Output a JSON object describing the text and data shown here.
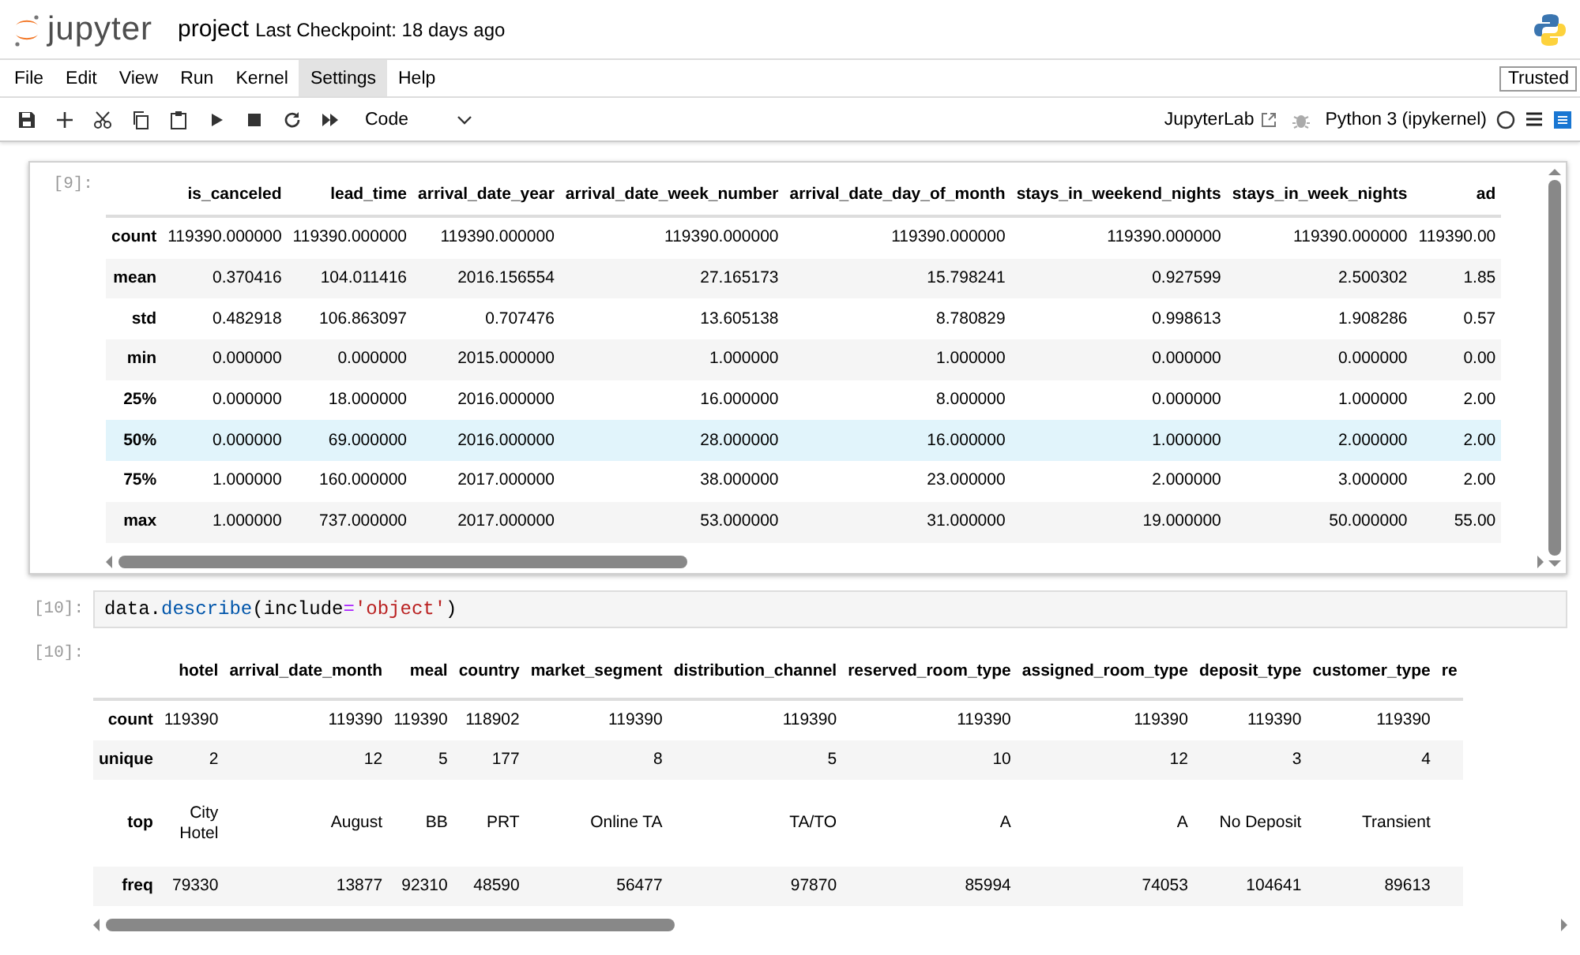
{
  "header": {
    "logo_text": "jupyter",
    "notebook_name": "project",
    "checkpoint": "Last Checkpoint: 18 days ago"
  },
  "menu": [
    {
      "label": "File",
      "selected": false
    },
    {
      "label": "Edit",
      "selected": false
    },
    {
      "label": "View",
      "selected": false
    },
    {
      "label": "Run",
      "selected": false
    },
    {
      "label": "Kernel",
      "selected": false
    },
    {
      "label": "Settings",
      "selected": true
    },
    {
      "label": "Help",
      "selected": false
    }
  ],
  "trusted": "Trusted",
  "toolbar": {
    "cell_type": "Code",
    "jupyterlab_link": "JupyterLab",
    "kernel": "Python 3 (ipykernel)",
    "kernel_busy": false
  },
  "cells": [
    {
      "kind": "output_only",
      "output_prompt": "[9]:",
      "table": {
        "columns": [
          "is_canceled",
          "lead_time",
          "arrival_date_year",
          "arrival_date_week_number",
          "arrival_date_day_of_month",
          "stays_in_weekend_nights",
          "stays_in_week_nights",
          "ad"
        ],
        "rows": [
          {
            "label": "count",
            "selected": false,
            "cells": [
              "119390.000000",
              "119390.000000",
              "119390.000000",
              "119390.000000",
              "119390.000000",
              "119390.000000",
              "119390.000000",
              "119390.00"
            ]
          },
          {
            "label": "mean",
            "selected": false,
            "cells": [
              "0.370416",
              "104.011416",
              "2016.156554",
              "27.165173",
              "15.798241",
              "0.927599",
              "2.500302",
              "1.85"
            ]
          },
          {
            "label": "std",
            "selected": false,
            "cells": [
              "0.482918",
              "106.863097",
              "0.707476",
              "13.605138",
              "8.780829",
              "0.998613",
              "1.908286",
              "0.57"
            ]
          },
          {
            "label": "min",
            "selected": false,
            "cells": [
              "0.000000",
              "0.000000",
              "2015.000000",
              "1.000000",
              "1.000000",
              "0.000000",
              "0.000000",
              "0.00"
            ]
          },
          {
            "label": "25%",
            "selected": false,
            "cells": [
              "0.000000",
              "18.000000",
              "2016.000000",
              "16.000000",
              "8.000000",
              "0.000000",
              "1.000000",
              "2.00"
            ]
          },
          {
            "label": "50%",
            "selected": true,
            "cells": [
              "0.000000",
              "69.000000",
              "2016.000000",
              "28.000000",
              "16.000000",
              "1.000000",
              "2.000000",
              "2.00"
            ]
          },
          {
            "label": "75%",
            "selected": false,
            "cells": [
              "1.000000",
              "160.000000",
              "2017.000000",
              "38.000000",
              "23.000000",
              "2.000000",
              "3.000000",
              "2.00"
            ]
          },
          {
            "label": "max",
            "selected": false,
            "cells": [
              "1.000000",
              "737.000000",
              "2017.000000",
              "53.000000",
              "31.000000",
              "19.000000",
              "50.000000",
              "55.00"
            ]
          }
        ]
      }
    },
    {
      "kind": "code",
      "input_prompt": "[10]:",
      "code": [
        {
          "text": "data.",
          "kind": "plain"
        },
        {
          "text": "describe",
          "kind": "attr"
        },
        {
          "text": "(include",
          "kind": "plain"
        },
        {
          "text": "=",
          "kind": "op"
        },
        {
          "text": "'object'",
          "kind": "string"
        },
        {
          "text": ")",
          "kind": "plain"
        }
      ],
      "output_prompt": "[10]:",
      "table": {
        "columns": [
          "hotel",
          "arrival_date_month",
          "meal",
          "country",
          "market_segment",
          "distribution_channel",
          "reserved_room_type",
          "assigned_room_type",
          "deposit_type",
          "customer_type",
          "re"
        ],
        "rows": [
          {
            "label": "count",
            "selected": false,
            "cells": [
              "119390",
              "119390",
              "119390",
              "118902",
              "119390",
              "119390",
              "119390",
              "119390",
              "119390",
              "119390",
              ""
            ]
          },
          {
            "label": "unique",
            "selected": false,
            "cells": [
              "2",
              "12",
              "5",
              "177",
              "8",
              "5",
              "10",
              "12",
              "3",
              "4",
              ""
            ]
          },
          {
            "label": "top",
            "selected": false,
            "cells": [
              "City Hotel",
              "August",
              "BB",
              "PRT",
              "Online TA",
              "TA/TO",
              "A",
              "A",
              "No Deposit",
              "Transient",
              ""
            ]
          },
          {
            "label": "freq",
            "selected": false,
            "cells": [
              "79330",
              "13877",
              "92310",
              "48590",
              "56477",
              "97870",
              "85994",
              "74053",
              "104641",
              "89613",
              ""
            ]
          }
        ]
      }
    }
  ]
}
